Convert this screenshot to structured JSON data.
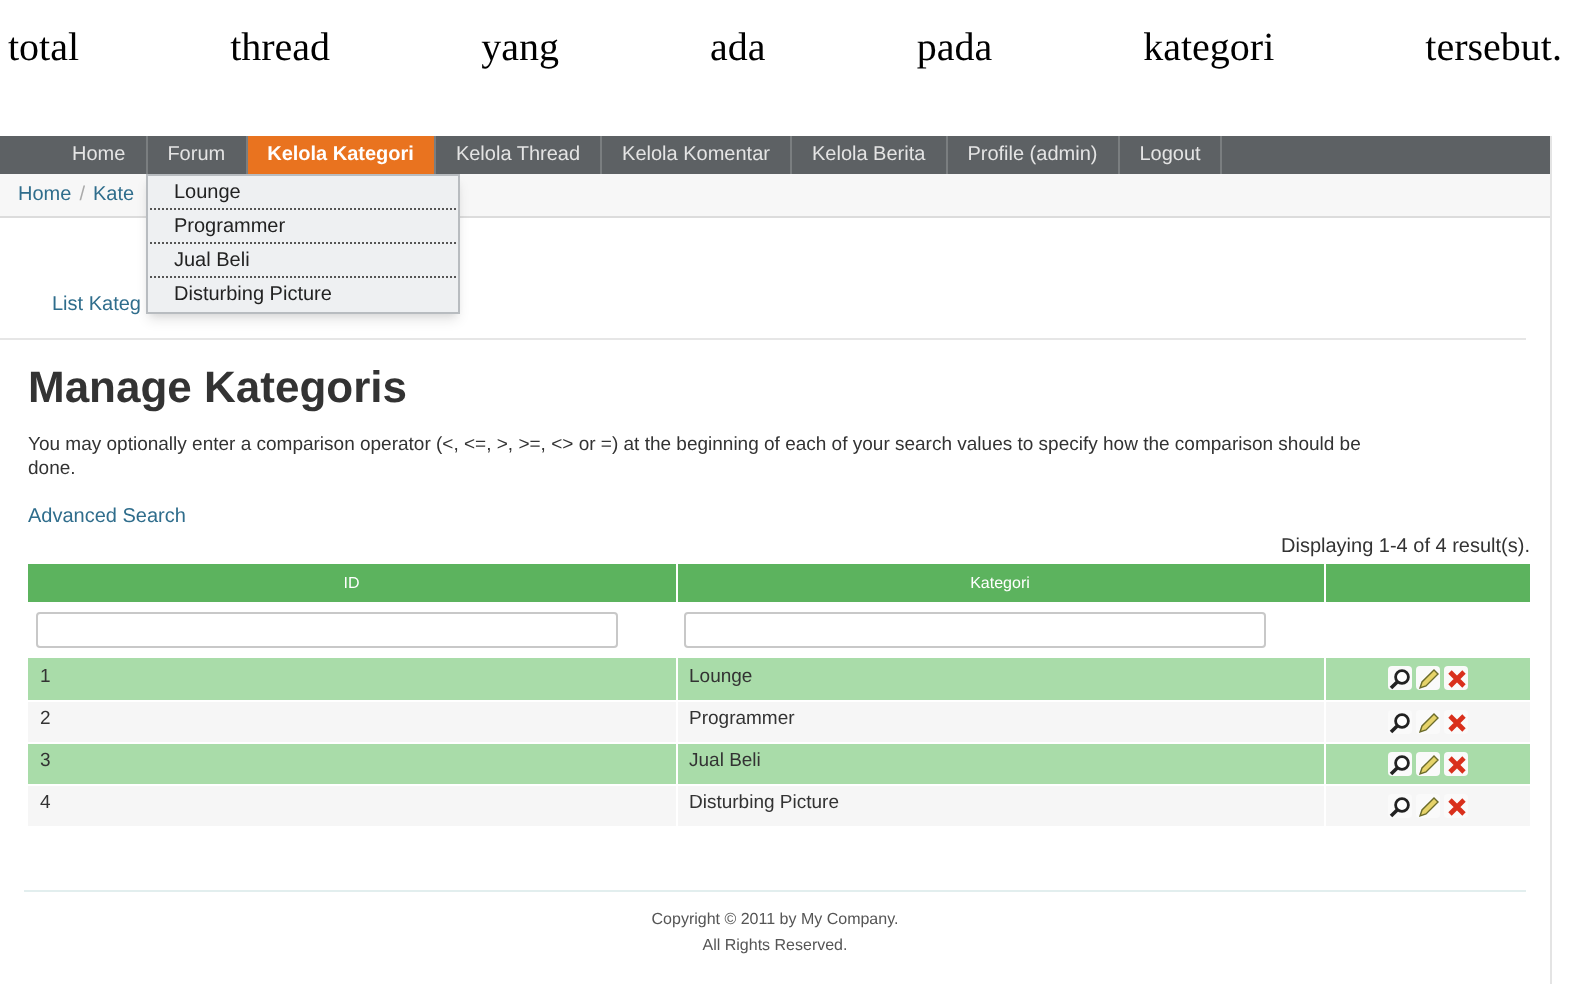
{
  "document_text": [
    "total",
    "thread",
    "yang",
    "ada",
    "pada",
    "kategori",
    "tersebut."
  ],
  "nav": [
    {
      "label": "Home",
      "selected": false
    },
    {
      "label": "Forum",
      "selected": false
    },
    {
      "label": "Kelola Kategori",
      "selected": true
    },
    {
      "label": "Kelola Thread",
      "selected": false
    },
    {
      "label": "Kelola Komentar",
      "selected": false
    },
    {
      "label": "Kelola Berita",
      "selected": false
    },
    {
      "label": "Profile (admin)",
      "selected": false
    },
    {
      "label": "Logout",
      "selected": false
    }
  ],
  "breadcrumb": [
    "Home",
    "/",
    "Kate"
  ],
  "dropdown": [
    "Lounge",
    "Programmer",
    "Jual Beli",
    "Disturbing Picture"
  ],
  "menu_link": "List Kateg",
  "title": "Manage Kategoris",
  "hint": "You may optionally enter a comparison operator (<, <=, >, >=, <> or =) at the beginning of each of your search values to specify how the comparison should be done.",
  "advanced_search": "Advanced Search",
  "summary": "Displaying 1-4 of 4 result(s).",
  "table": {
    "columns": [
      "ID",
      "Kategori"
    ],
    "rows": [
      [
        "1",
        "Lounge"
      ],
      [
        "2",
        "Programmer"
      ],
      [
        "3",
        "Jual Beli"
      ],
      [
        "4",
        "Disturbing Picture"
      ]
    ]
  },
  "footer": [
    "Copyright © 2011 by My Company.",
    "All Rights Reserved."
  ]
}
